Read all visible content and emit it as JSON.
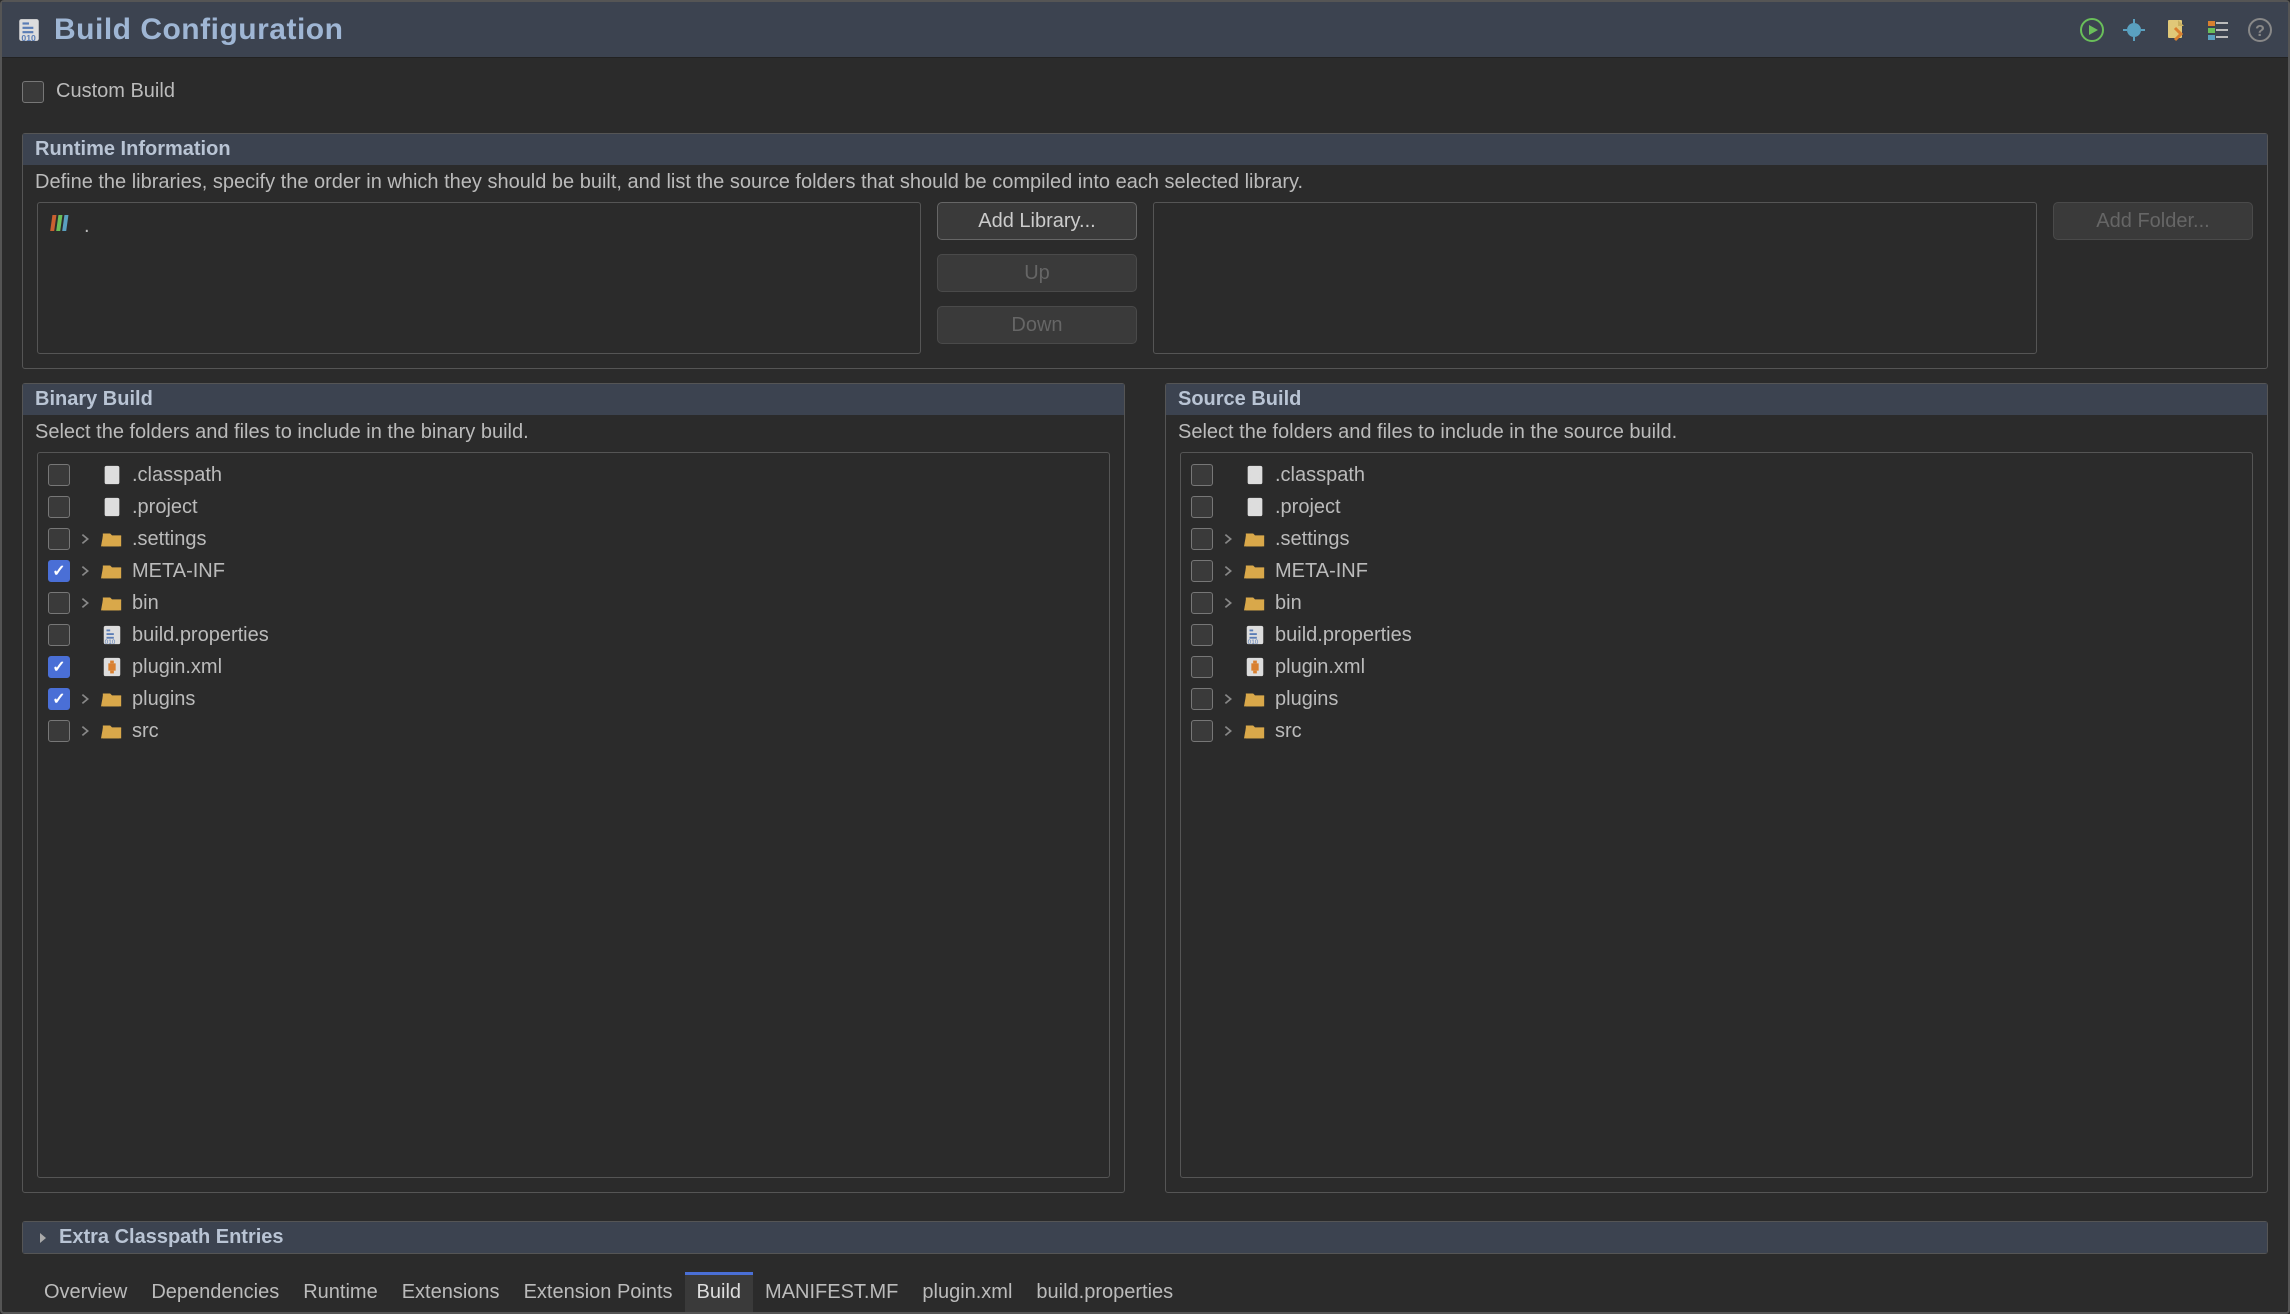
{
  "title": "Build Configuration",
  "custom_build_label": "Custom Build",
  "runtime": {
    "heading": "Runtime Information",
    "description": "Define the libraries, specify the order in which they should be built, and list the source folders that should be compiled into each selected library.",
    "library_item": ".",
    "buttons": {
      "add_library": "Add Library...",
      "up": "Up",
      "down": "Down",
      "add_folder": "Add Folder..."
    }
  },
  "binary_build": {
    "heading": "Binary Build",
    "description": "Select the folders and files to include in the binary build.",
    "items": [
      {
        "name": ".classpath",
        "type": "file",
        "checked": false,
        "expandable": false
      },
      {
        "name": ".project",
        "type": "file",
        "checked": false,
        "expandable": false
      },
      {
        "name": ".settings",
        "type": "folder",
        "checked": false,
        "expandable": true
      },
      {
        "name": "META-INF",
        "type": "folder",
        "checked": true,
        "expandable": true
      },
      {
        "name": "bin",
        "type": "folder",
        "checked": false,
        "expandable": true
      },
      {
        "name": "build.properties",
        "type": "propfile",
        "checked": false,
        "expandable": false
      },
      {
        "name": "plugin.xml",
        "type": "pluginfile",
        "checked": true,
        "expandable": false
      },
      {
        "name": "plugins",
        "type": "folder",
        "checked": true,
        "expandable": true
      },
      {
        "name": "src",
        "type": "folder",
        "checked": false,
        "expandable": true
      }
    ]
  },
  "source_build": {
    "heading": "Source Build",
    "description": "Select the folders and files to include in the source build.",
    "items": [
      {
        "name": ".classpath",
        "type": "file",
        "checked": false,
        "expandable": false
      },
      {
        "name": ".project",
        "type": "file",
        "checked": false,
        "expandable": false
      },
      {
        "name": ".settings",
        "type": "folder",
        "checked": false,
        "expandable": true
      },
      {
        "name": "META-INF",
        "type": "folder",
        "checked": false,
        "expandable": true
      },
      {
        "name": "bin",
        "type": "folder",
        "checked": false,
        "expandable": true
      },
      {
        "name": "build.properties",
        "type": "propfile",
        "checked": false,
        "expandable": false
      },
      {
        "name": "plugin.xml",
        "type": "pluginfile",
        "checked": false,
        "expandable": false
      },
      {
        "name": "plugins",
        "type": "folder",
        "checked": false,
        "expandable": true
      },
      {
        "name": "src",
        "type": "folder",
        "checked": false,
        "expandable": true
      }
    ]
  },
  "extra_classpath_heading": "Extra Classpath Entries",
  "tabs": [
    "Overview",
    "Dependencies",
    "Runtime",
    "Extensions",
    "Extension Points",
    "Build",
    "MANIFEST.MF",
    "plugin.xml",
    "build.properties"
  ],
  "active_tab": "Build",
  "toolbar_icons": [
    "run-icon",
    "debug-icon",
    "export-icon",
    "organize-icon",
    "help-icon"
  ]
}
